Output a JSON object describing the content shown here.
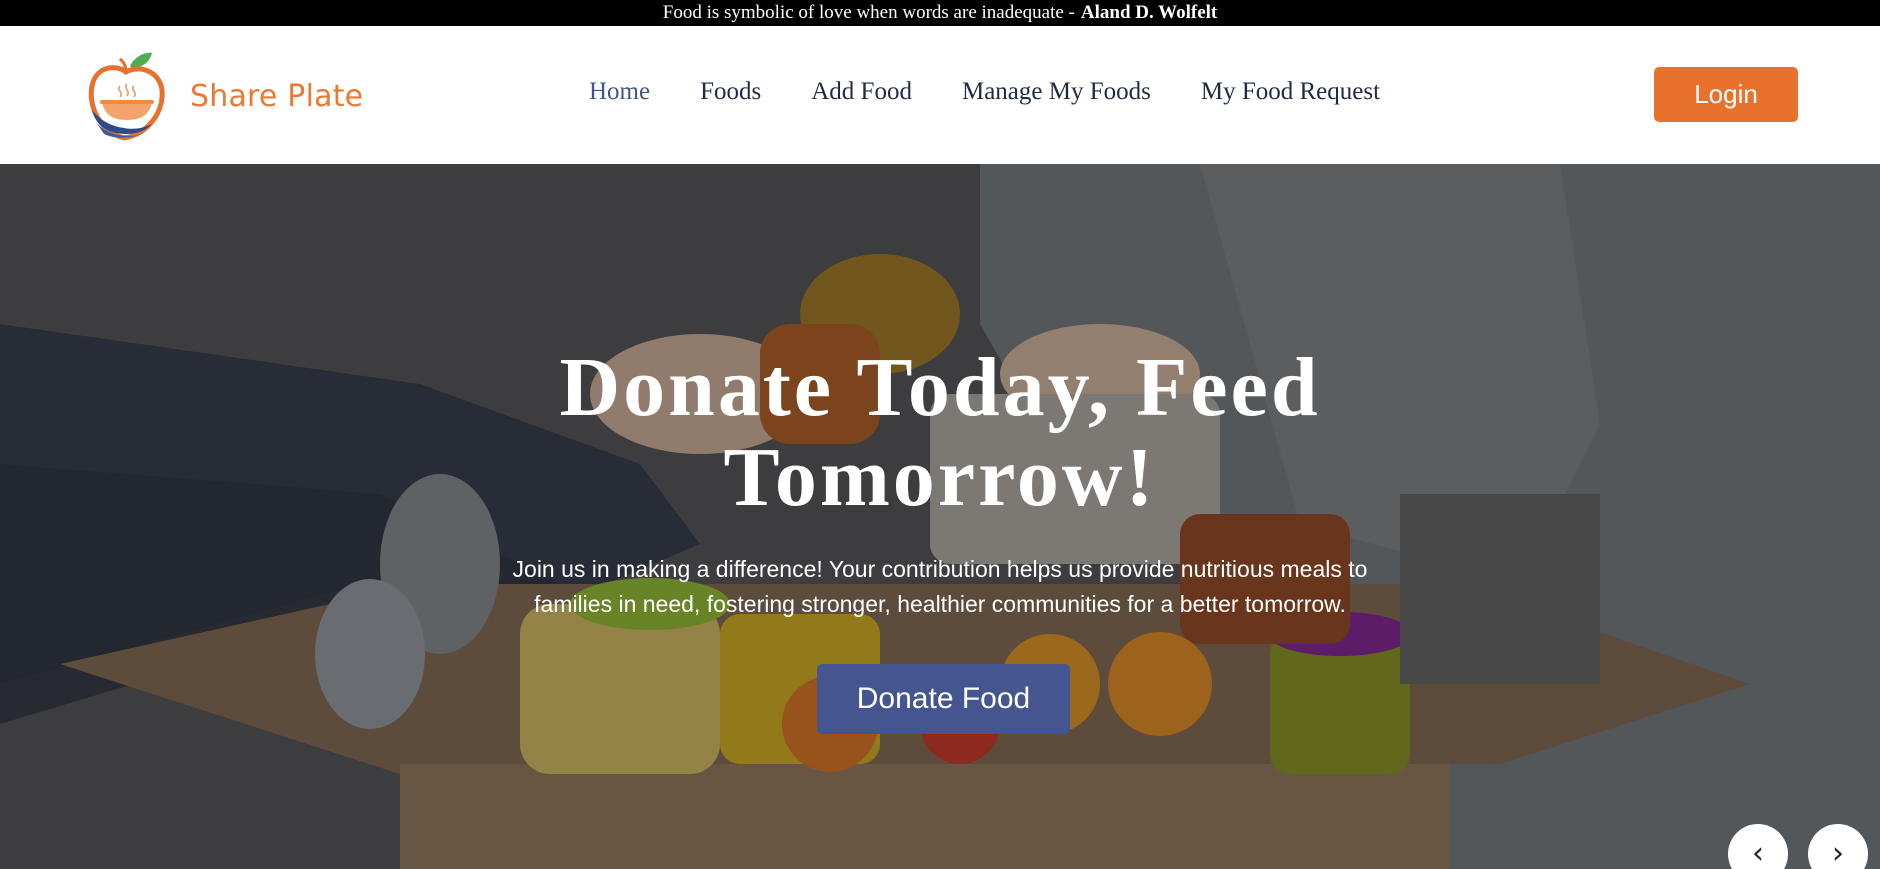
{
  "topbar": {
    "quote": "Food is symbolic of love when words are inadequate -",
    "author": "Aland D. Wolfelt"
  },
  "brand": {
    "name": "Share Plate",
    "logo_icon": "apple-bowl-hand-logo",
    "accent_color": "#ea7a33"
  },
  "nav": {
    "items": [
      {
        "label": "Home",
        "active": true
      },
      {
        "label": "Foods"
      },
      {
        "label": "Add Food"
      },
      {
        "label": "Manage My Foods"
      },
      {
        "label": "My Food Request"
      }
    ],
    "login_label": "Login",
    "login_color": "#e8712c"
  },
  "hero": {
    "title": "Donate Today, Feed Tomorrow!",
    "description": "Join us in making a difference! Your contribution helps us provide nutritious meals to families in need, fostering stronger, healthier communities for a better tomorrow.",
    "button_label": "Donate Food",
    "button_color": "#44558f",
    "prev_icon": "‹",
    "next_icon": "›"
  }
}
